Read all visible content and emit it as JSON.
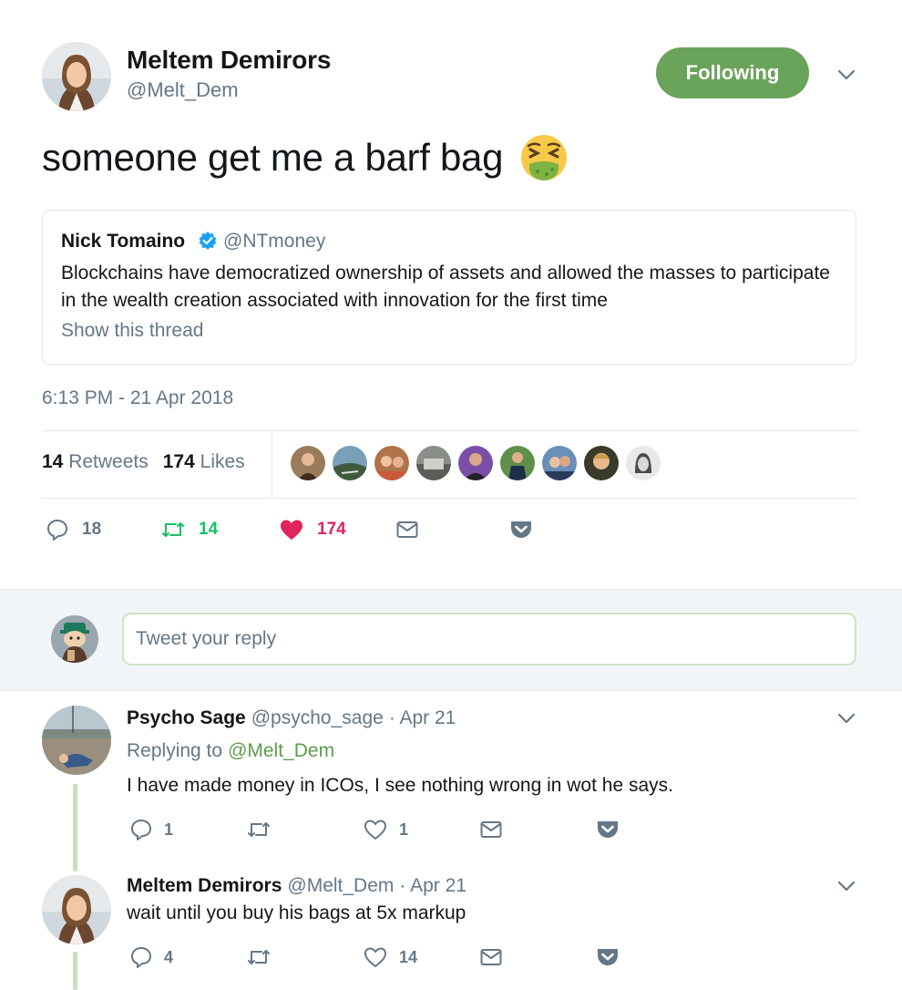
{
  "tweet": {
    "author_name": "Meltem Demirors",
    "author_handle": "@Melt_Dem",
    "follow_label": "Following",
    "text": "someone get me a barf bag",
    "emoji": "nauseated-face-icon",
    "timestamp": "6:13 PM - 21 Apr 2018",
    "retweets_count": "14",
    "retweets_label": "Retweets",
    "likes_count": "174",
    "likes_label": "Likes",
    "reply_count": "18",
    "retweet_action_count": "14",
    "like_action_count": "174"
  },
  "quote": {
    "name": "Nick Tomaino",
    "handle": "@NTmoney",
    "text": "Blockchains have democratized ownership of assets and allowed the masses to participate in the wealth creation associated with innovation for the first time",
    "show_thread": "Show this thread"
  },
  "composer": {
    "placeholder": "Tweet your reply"
  },
  "replies": [
    {
      "name": "Psycho Sage",
      "handle": "@psycho_sage",
      "date": "· Apr 21",
      "replying_to_label": "Replying to",
      "replying_to": "@Melt_Dem",
      "text": "I have made money in ICOs, I see nothing wrong in wot he says.",
      "reply_count": "1",
      "retweet_count": "",
      "like_count": "1"
    },
    {
      "name": "Meltem Demirors",
      "handle": "@Melt_Dem",
      "date": "· Apr 21",
      "text": "wait until you buy his bags at 5x markup",
      "reply_count": "4",
      "retweet_count": "",
      "like_count": "14"
    }
  ],
  "colors": {
    "following_green": "#6aa35a",
    "retweet_green": "#17bf63",
    "like_red": "#e0245e",
    "secondary_text": "#657786",
    "border": "#e1e8ed",
    "verified_blue": "#1da1f2"
  }
}
